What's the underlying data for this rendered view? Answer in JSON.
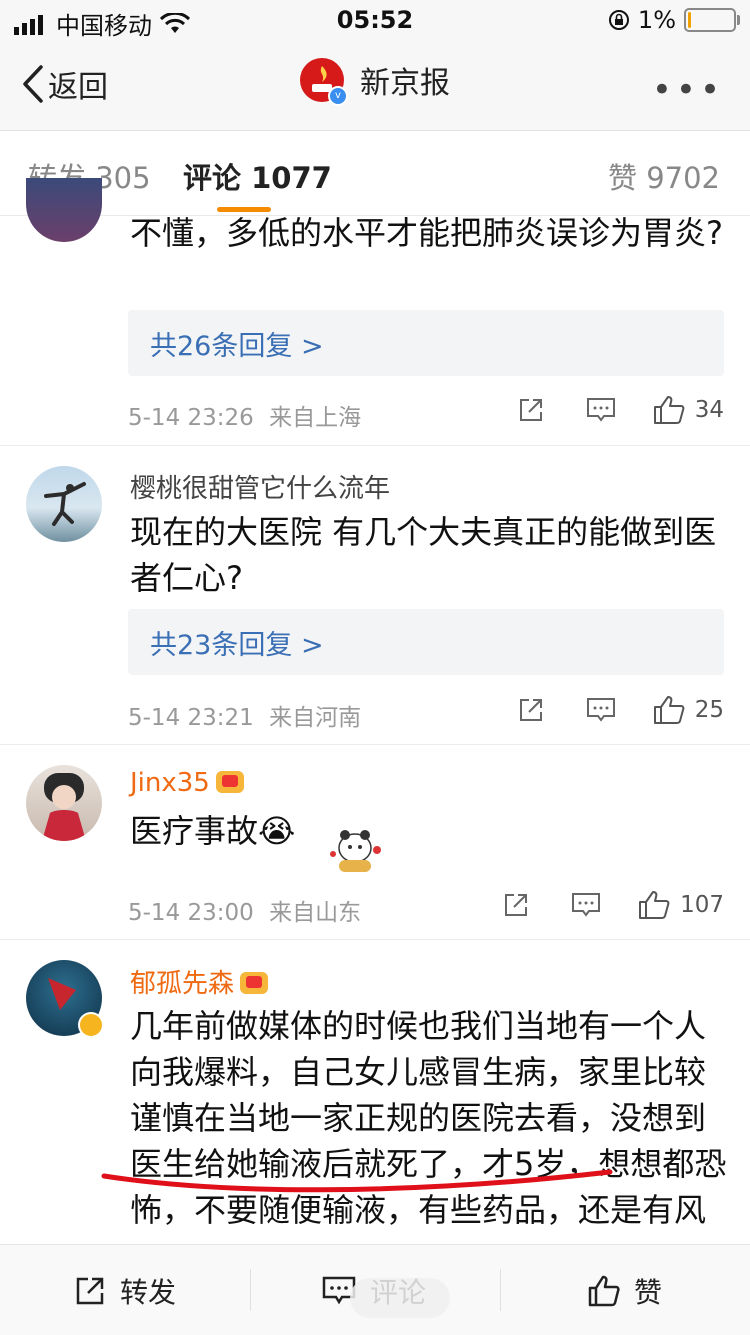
{
  "status_bar": {
    "carrier": "中国移动",
    "time": "05:52",
    "battery_percent": "1%"
  },
  "nav": {
    "back_label": "返回",
    "title": "新京报",
    "logo_text": "新京报"
  },
  "tabs": [
    {
      "label": "转发",
      "count": "305"
    },
    {
      "label": "评论",
      "count": "1077"
    },
    {
      "label": "赞",
      "count": "9702"
    }
  ],
  "comments": [
    {
      "user": "",
      "text": "不懂，多低的水平才能把肺炎误诊为胃炎?",
      "replies": "共26条回复 >",
      "time": "5-14 23:26",
      "source": "来自上海",
      "likes": "34"
    },
    {
      "user": "樱桃很甜管它什么流年",
      "text": "现在的大医院 有几个大夫真正的能做到医者仁心?",
      "replies": "共23条回复 >",
      "time": "5-14 23:21",
      "source": "来自河南",
      "likes": "25"
    },
    {
      "user": "Jinx35",
      "text": "医疗事故",
      "emoji": "😭",
      "time": "5-14 23:00",
      "source": "来自山东",
      "likes": "107"
    },
    {
      "user": "郁孤先森",
      "text": "几年前做媒体的时候也我们当地有一个人向我爆料，自己女儿感冒生病，家里比较谨慎在当地一家正规的医院去看，没想到医生给她输液后就死了，才5岁，想想都恐怖，不要随便输液，有些药品，还是有风险的"
    }
  ],
  "bottom_bar": {
    "repost": "转发",
    "comment": "评论",
    "like": "赞"
  },
  "colors": {
    "accent": "#f58b00",
    "vip_name": "#ef6a12",
    "link": "#3a6fb5",
    "underline_mark": "#e0101a"
  }
}
